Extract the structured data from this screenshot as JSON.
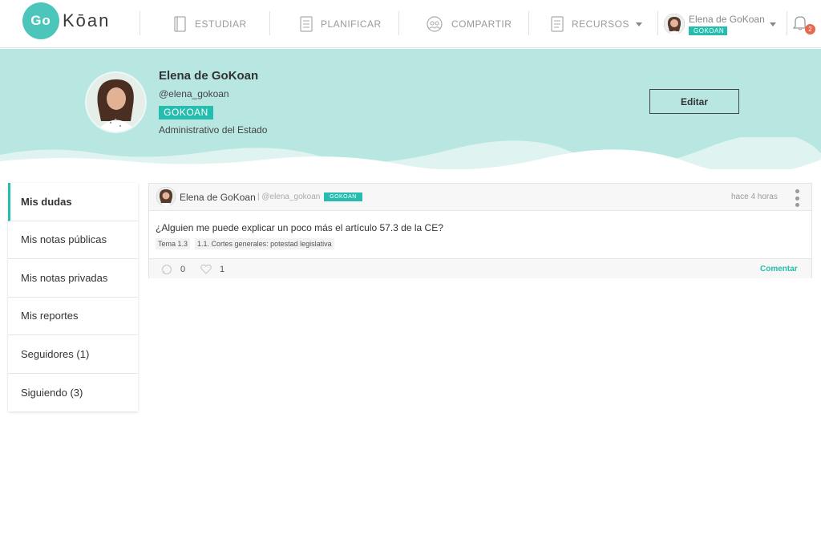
{
  "brand": {
    "logo_go": "Go",
    "logo_word": "Kōan",
    "accent": "#26bcae"
  },
  "nav": {
    "estudiar": "ESTUDIAR",
    "planificar": "PLANIFICAR",
    "compartir": "COMPARTIR",
    "recursos": "RECURSOS"
  },
  "user_menu": {
    "name": "Elena de GoKoan",
    "badge": "GOKOAN",
    "notifications": "2"
  },
  "profile": {
    "name": "Elena de GoKoan",
    "handle": "@elena_gokoan",
    "badge": "GOKOAN",
    "role": "Administrativo del Estado",
    "edit_label": "Editar"
  },
  "sidebar": {
    "items": [
      {
        "label": "Mis dudas"
      },
      {
        "label": "Mis notas públicas"
      },
      {
        "label": "Mis notas privadas"
      },
      {
        "label": "Mis reportes"
      },
      {
        "label": "Seguidores (1)"
      },
      {
        "label": "Siguiendo (3)"
      }
    ]
  },
  "post": {
    "author": "Elena de GoKoan",
    "handle": "| @elena_gokoan",
    "badge": "GOKOAN",
    "time": "hace 4 horas",
    "body": "¿Alguien me puede explicar un poco más el artículo 57.3 de la CE?",
    "tags": [
      "Tema 1.3",
      "1.1. Cortes generales: potestad legislativa"
    ],
    "comments": "0",
    "likes": "1",
    "comment_label": "Comentar"
  }
}
